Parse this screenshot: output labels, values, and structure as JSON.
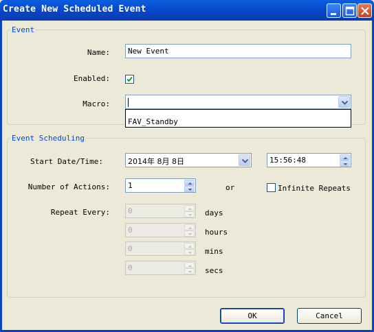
{
  "window": {
    "title": "Create New Scheduled Event"
  },
  "event_group": {
    "legend": "Event",
    "name_label": "Name:",
    "name_value": "New Event",
    "enabled_label": "Enabled:",
    "enabled_checked": true,
    "macro_label": "Macro:",
    "macro_value": "",
    "macro_options": [
      "FAV_Standby"
    ]
  },
  "scheduling_group": {
    "legend": "Event Scheduling",
    "start_label": "Start Date/Time:",
    "start_date": "2014年 8月 8日",
    "start_time": "15:56:48",
    "actions_label": "Number of Actions:",
    "actions_value": "1",
    "or_text": "or",
    "infinite_label": "Infinite Repeats",
    "infinite_checked": false,
    "repeat_label": "Repeat Every:",
    "repeat": [
      {
        "value": "0",
        "unit": "days"
      },
      {
        "value": "0",
        "unit": "hours"
      },
      {
        "value": "0",
        "unit": "mins"
      },
      {
        "value": "0",
        "unit": "secs"
      }
    ]
  },
  "buttons": {
    "ok": "OK",
    "cancel": "Cancel"
  }
}
